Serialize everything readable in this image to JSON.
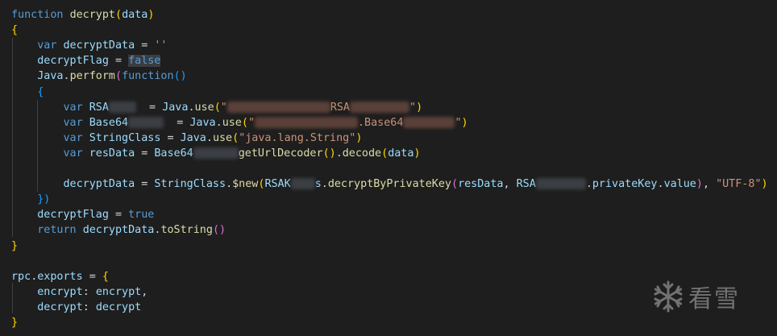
{
  "editor": {
    "lines": [
      [
        {
          "t": "function",
          "c": "kw"
        },
        {
          "t": " "
        },
        {
          "t": "decrypt",
          "c": "fn"
        },
        {
          "t": "(",
          "c": "b1"
        },
        {
          "t": "data",
          "c": "var"
        },
        {
          "t": ")",
          "c": "b1"
        }
      ],
      [
        {
          "t": "{",
          "c": "b1"
        }
      ],
      [
        {
          "t": "    "
        },
        {
          "t": "var",
          "c": "kw"
        },
        {
          "t": " "
        },
        {
          "t": "decryptData",
          "c": "var"
        },
        {
          "t": " = "
        },
        {
          "t": "''",
          "c": "str"
        }
      ],
      [
        {
          "t": "    "
        },
        {
          "t": "decryptFlag",
          "c": "var"
        },
        {
          "t": " = "
        },
        {
          "t": "false",
          "c": "kw hl"
        }
      ],
      [
        {
          "t": "    "
        },
        {
          "t": "Java",
          "c": "var"
        },
        {
          "t": "."
        },
        {
          "t": "perform",
          "c": "fn"
        },
        {
          "t": "(",
          "c": "b2"
        },
        {
          "t": "function",
          "c": "kw"
        },
        {
          "t": "()",
          "c": "b3"
        }
      ],
      [
        {
          "t": "    "
        },
        {
          "t": "{",
          "c": "b3"
        }
      ],
      [
        {
          "t": "        "
        },
        {
          "t": "var",
          "c": "kw"
        },
        {
          "t": " "
        },
        {
          "t": "RSA",
          "c": "var"
        },
        {
          "blur": 34
        },
        {
          "t": "  = "
        },
        {
          "t": "Java",
          "c": "var"
        },
        {
          "t": "."
        },
        {
          "t": "use",
          "c": "fn"
        },
        {
          "t": "(",
          "c": "b1"
        },
        {
          "t": "\"",
          "c": "str"
        },
        {
          "blur": 128,
          "red": true
        },
        {
          "t": "RSA",
          "c": "str"
        },
        {
          "blur": 74,
          "red": true
        },
        {
          "t": "\"",
          "c": "str"
        },
        {
          "t": ")",
          "c": "b1"
        }
      ],
      [
        {
          "t": "        "
        },
        {
          "t": "var",
          "c": "kw"
        },
        {
          "t": " "
        },
        {
          "t": "Base64",
          "c": "var"
        },
        {
          "blur": 44
        },
        {
          "t": "  = "
        },
        {
          "t": "Java",
          "c": "var"
        },
        {
          "t": "."
        },
        {
          "t": "use",
          "c": "fn"
        },
        {
          "t": "(",
          "c": "b1"
        },
        {
          "t": "\"",
          "c": "str"
        },
        {
          "blur": 128,
          "red": true
        },
        {
          "t": ".Base64",
          "c": "str"
        },
        {
          "blur": 64,
          "red": true
        },
        {
          "t": "\"",
          "c": "str"
        },
        {
          "t": ")",
          "c": "b1"
        }
      ],
      [
        {
          "t": "        "
        },
        {
          "t": "var",
          "c": "kw"
        },
        {
          "t": " "
        },
        {
          "t": "StringClass",
          "c": "var"
        },
        {
          "t": " = "
        },
        {
          "t": "Java",
          "c": "var"
        },
        {
          "t": "."
        },
        {
          "t": "use",
          "c": "fn"
        },
        {
          "t": "(",
          "c": "b1"
        },
        {
          "t": "\"java.lang.String\"",
          "c": "str"
        },
        {
          "t": ")",
          "c": "b1"
        }
      ],
      [
        {
          "t": "        "
        },
        {
          "t": "var",
          "c": "kw"
        },
        {
          "t": " "
        },
        {
          "t": "resData",
          "c": "var"
        },
        {
          "t": " = "
        },
        {
          "t": "Base64",
          "c": "var"
        },
        {
          "blur": 56
        },
        {
          "t": "getUrlDecoder",
          "c": "fn"
        },
        {
          "t": "()",
          "c": "b1"
        },
        {
          "t": "."
        },
        {
          "t": "decode",
          "c": "fn"
        },
        {
          "t": "(",
          "c": "b1"
        },
        {
          "t": "data",
          "c": "var"
        },
        {
          "t": ")",
          "c": "b1"
        }
      ],
      [],
      [
        {
          "t": "        "
        },
        {
          "t": "decryptData",
          "c": "var"
        },
        {
          "t": " = "
        },
        {
          "t": "StringClass",
          "c": "var"
        },
        {
          "t": "."
        },
        {
          "t": "$new",
          "c": "fn"
        },
        {
          "t": "(",
          "c": "b1"
        },
        {
          "t": "RSAK",
          "c": "var"
        },
        {
          "blur": 30
        },
        {
          "t": "s",
          "c": "var"
        },
        {
          "t": "."
        },
        {
          "t": "decryptByPrivateKey",
          "c": "fn"
        },
        {
          "t": "(",
          "c": "b2"
        },
        {
          "t": "resData",
          "c": "var"
        },
        {
          "t": ", "
        },
        {
          "t": "RSA",
          "c": "var"
        },
        {
          "blur": 62
        },
        {
          "t": "."
        },
        {
          "t": "privateKey",
          "c": "var"
        },
        {
          "t": "."
        },
        {
          "t": "value",
          "c": "var"
        },
        {
          "t": ")",
          "c": "b2"
        },
        {
          "t": ", "
        },
        {
          "t": "\"UTF-8\"",
          "c": "str"
        },
        {
          "t": ")",
          "c": "b1"
        }
      ],
      [
        {
          "t": "    "
        },
        {
          "t": "})",
          "c": "b3"
        }
      ],
      [
        {
          "t": "    "
        },
        {
          "t": "decryptFlag",
          "c": "var"
        },
        {
          "t": " = "
        },
        {
          "t": "true",
          "c": "kw"
        }
      ],
      [
        {
          "t": "    "
        },
        {
          "t": "return",
          "c": "kw"
        },
        {
          "t": " "
        },
        {
          "t": "decryptData",
          "c": "var"
        },
        {
          "t": "."
        },
        {
          "t": "toString",
          "c": "fn"
        },
        {
          "t": "()",
          "c": "b2"
        }
      ],
      [
        {
          "t": "}",
          "c": "b1"
        }
      ],
      [],
      [
        {
          "t": "rpc",
          "c": "var"
        },
        {
          "t": "."
        },
        {
          "t": "exports",
          "c": "var"
        },
        {
          "t": " = "
        },
        {
          "t": "{",
          "c": "b1"
        }
      ],
      [
        {
          "t": "    "
        },
        {
          "t": "encrypt",
          "c": "var"
        },
        {
          "t": ": "
        },
        {
          "t": "encrypt",
          "c": "var"
        },
        {
          "t": ","
        }
      ],
      [
        {
          "t": "    "
        },
        {
          "t": "decrypt",
          "c": "var"
        },
        {
          "t": ": "
        },
        {
          "t": "decrypt",
          "c": "var"
        }
      ],
      [
        {
          "t": "}",
          "c": "b1"
        }
      ]
    ]
  },
  "watermark": {
    "text": "看雪",
    "icon": "snowflake-icon"
  },
  "colors": {
    "background": "#1e1e1e",
    "keyword": "#569cd6",
    "function": "#dcdcaa",
    "variable": "#9cdcfe",
    "string": "#ce9178",
    "bracket_gold": "#ffd700",
    "bracket_purple": "#da70d6",
    "bracket_blue": "#179fff"
  }
}
